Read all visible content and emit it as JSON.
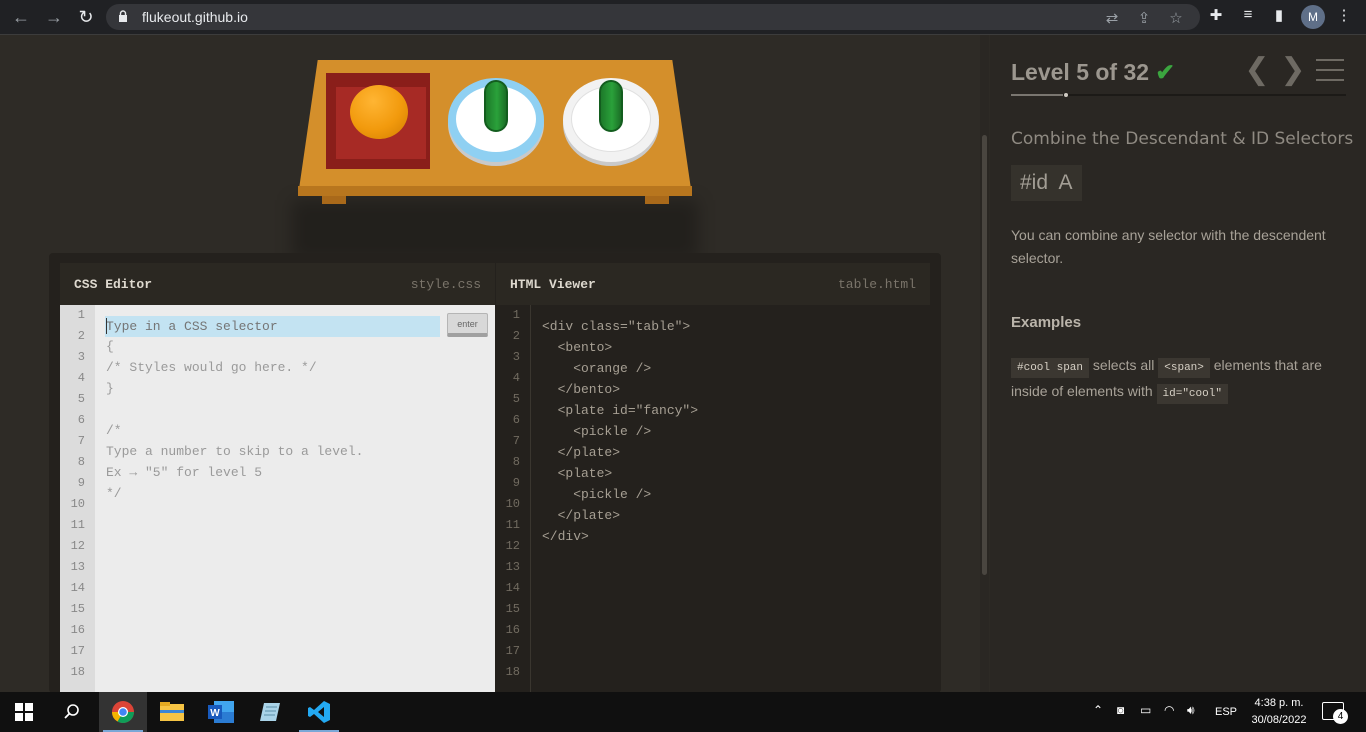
{
  "browser": {
    "url": "flukeout.github.io",
    "profile_initial": "M"
  },
  "level": {
    "title": "Level 5 of 32",
    "check": "✔",
    "progress_fraction": 0.156,
    "prev_arrow": "❮",
    "next_arrow": "❯"
  },
  "lesson": {
    "subtitle": "Combine the Descendant & ID Selectors",
    "syntax": "#id  A",
    "description": "You can combine any selector with the descendent selector.",
    "examples_heading": "Examples",
    "example": {
      "code1": "#cool span",
      "text1": "selects all",
      "code2": "<span>",
      "text2": "elements that are inside of elements with",
      "code3": "id=\"cool\""
    }
  },
  "css_editor": {
    "title": "CSS Editor",
    "filename": "style.css",
    "input_placeholder": "Type in a CSS selector",
    "enter_label": "enter",
    "lines": [
      "{",
      "/* Styles would go here. */",
      "}",
      "",
      "/*",
      "Type a number to skip to a level.",
      "Ex → \"5\" for level 5",
      "*/"
    ],
    "line_numbers": [
      "1",
      "2",
      "3",
      "4",
      "5",
      "6",
      "7",
      "8",
      "9",
      "10",
      "11",
      "12",
      "13",
      "14",
      "15",
      "16",
      "17",
      "18"
    ]
  },
  "html_viewer": {
    "title": "HTML Viewer",
    "filename": "table.html",
    "lines": [
      "<div class=\"table\">",
      "  <bento>",
      "    <orange />",
      "  </bento>",
      "  <plate id=\"fancy\">",
      "    <pickle />",
      "  </plate>",
      "  <plate>",
      "    <pickle />",
      "  </plate>",
      "</div>"
    ],
    "line_numbers": [
      "1",
      "2",
      "3",
      "4",
      "5",
      "6",
      "7",
      "8",
      "9",
      "10",
      "11",
      "12",
      "13",
      "14",
      "15",
      "16",
      "17",
      "18"
    ]
  },
  "taskbar": {
    "language": "ESP",
    "time": "4:38 p. m.",
    "date": "30/08/2022",
    "notification_count": "4"
  },
  "colors": {
    "accent_check": "#3ba53f",
    "table": "#d48f2b",
    "pickle": "#2aa13a",
    "orange": "#f29a0d"
  }
}
